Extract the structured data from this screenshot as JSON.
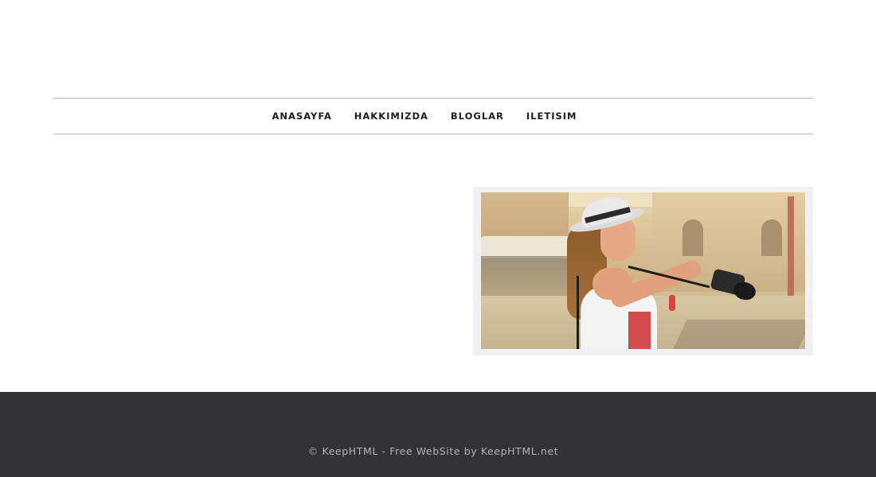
{
  "nav": {
    "items": [
      {
        "label": "ANASAYFA"
      },
      {
        "label": "HAKKIMIZDA"
      },
      {
        "label": "BLOGLAR"
      },
      {
        "label": "ILETISIM"
      }
    ]
  },
  "main": {
    "image": {
      "subject": "woman-with-camera-photo"
    }
  },
  "footer": {
    "copyright": "© KeepHTML - Free WebSite by KeepHTML.net"
  }
}
